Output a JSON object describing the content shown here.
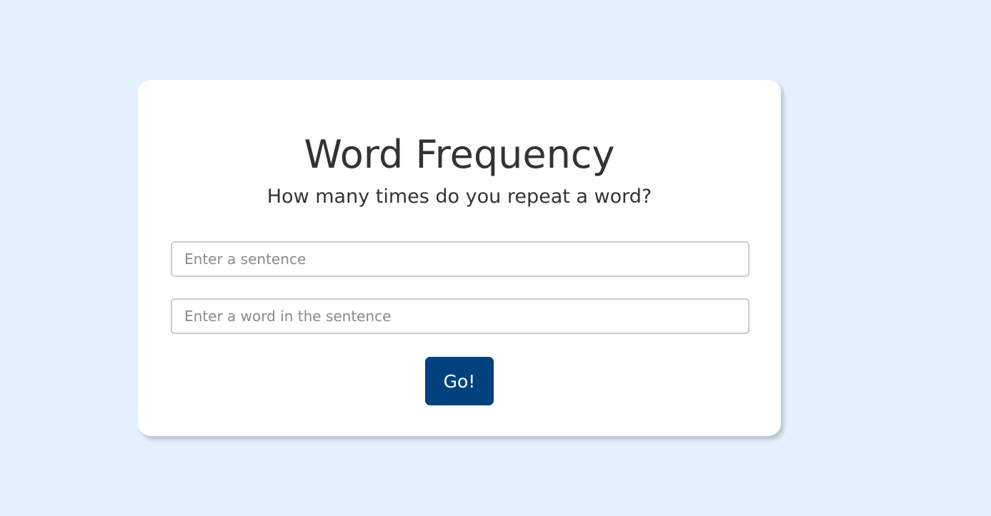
{
  "card": {
    "title": "Word Frequency",
    "subtitle": "How many times do you repeat a word?"
  },
  "form": {
    "sentence_placeholder": "Enter a sentence",
    "sentence_value": "",
    "word_placeholder": "Enter a word in the sentence",
    "word_value": "",
    "submit_label": "Go!"
  },
  "colors": {
    "background": "#e3f0fd",
    "card": "#ffffff",
    "button": "#00427d",
    "text": "#333333"
  }
}
